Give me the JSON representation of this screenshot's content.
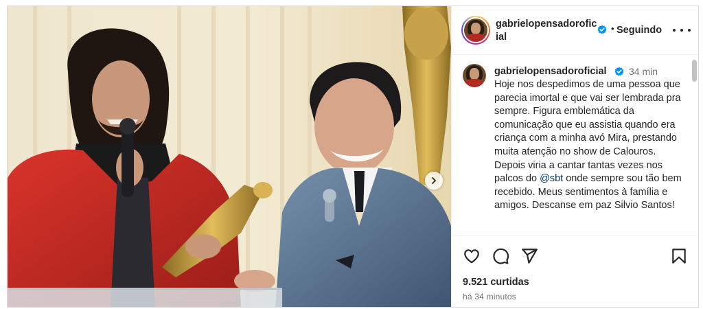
{
  "post": {
    "username": "gabrielopensadoroficial",
    "follow_status": "Seguindo",
    "separator": "•",
    "caption": {
      "username": "gabrielopensadoroficial",
      "time": "34 min",
      "text_before_mention": "Hoje nos despedimos de uma pessoa que parecia imortal e que vai ser lembrada pra sempre. Figura emblemática da comunicação que eu assistia quando era criança com a minha avó Mira, prestando muita atenção no show de Calouros. Depois viria a cantar tantas vezes nos palcos do ",
      "mention": "@sbt",
      "text_after_mention": " onde sempre sou tão bem recebido. Meus sentimentos à família e amigos. Descanse em paz Silvio Santos!"
    },
    "likes": "9.521 curtidas",
    "posted_ago": "há 34 minutos"
  },
  "icons": {
    "verified": "verified-badge-icon",
    "more": "more-options-icon",
    "like": "heart-icon",
    "comment": "comment-icon",
    "share": "share-icon",
    "save": "bookmark-icon",
    "next": "chevron-right-icon"
  },
  "colors": {
    "verified": "#0095f6",
    "mention": "#00376b",
    "secondary_text": "#737373"
  }
}
